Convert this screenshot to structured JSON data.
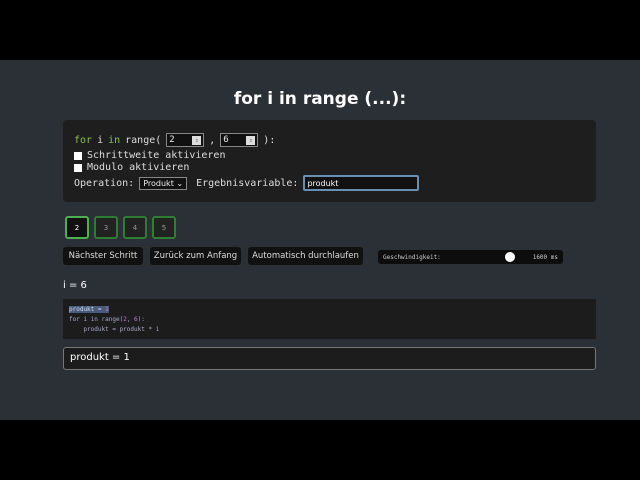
{
  "title": "for i in range (...):",
  "config": {
    "for_kw": "for",
    "var": "i",
    "in_kw": "in",
    "range_open": "range(",
    "start": "2",
    "comma": ",",
    "end": "6",
    "range_close": "):",
    "step_label": "Schrittweite aktivieren",
    "modulo_label": "Modulo aktivieren",
    "operation_label": "Operation:",
    "operation_value": "Produkt",
    "result_label": "Ergebnisvariable:",
    "result_value": "produkt"
  },
  "steps": [
    "2",
    "3",
    "4",
    "5"
  ],
  "buttons": {
    "next": "Nächster Schritt",
    "reset": "Zurück zum Anfang",
    "auto": "Automatisch durchlaufen"
  },
  "speed": {
    "label": "Geschwindigkeit:",
    "value": "1600 ms",
    "fraction": 0.7
  },
  "current": "i = 6",
  "code": {
    "l1a": "produkt = ",
    "l1b": "1",
    "l2a": "for i in range(",
    "l2b": "2",
    "l2c": ", ",
    "l2d": "6",
    "l2e": "):",
    "l3": "    produkt = produkt * i"
  },
  "output": "produkt = 1"
}
